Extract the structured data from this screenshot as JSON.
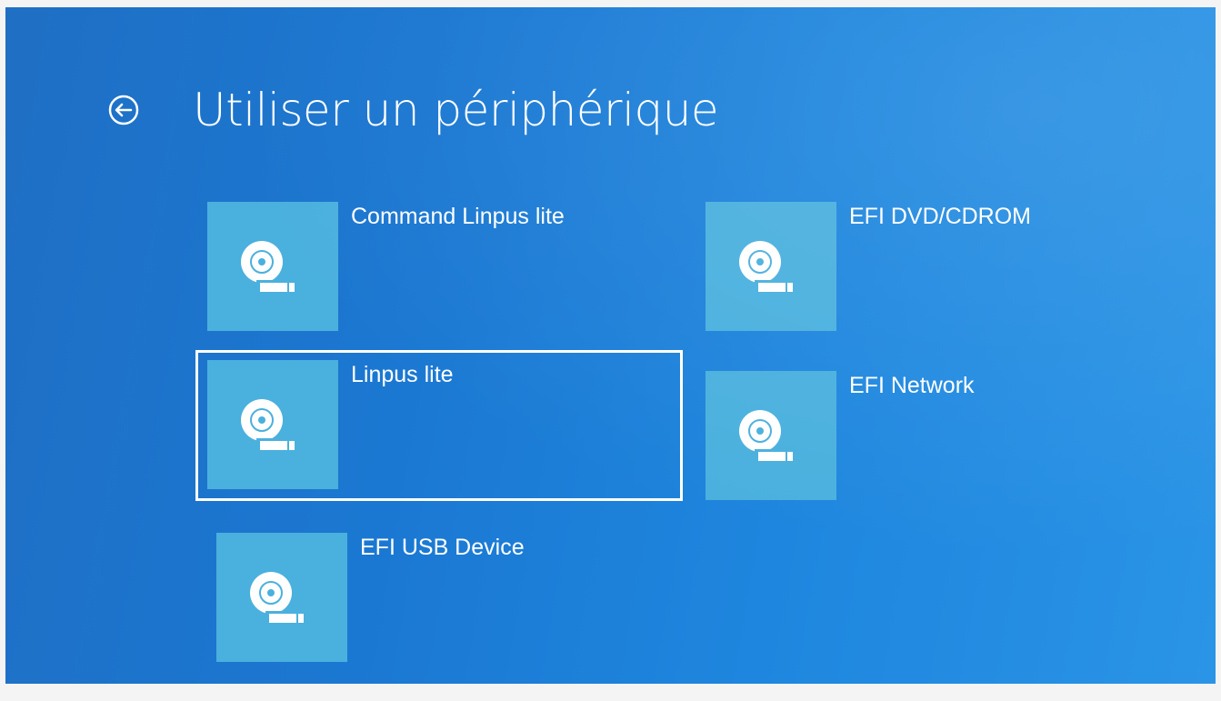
{
  "header": {
    "title": "Utiliser un périphérique",
    "back_icon": "back-arrow-circle-icon"
  },
  "devices": [
    {
      "label": "Command Linpus lite",
      "icon": "disc-drive-icon",
      "selected": false
    },
    {
      "label": "EFI DVD/CDROM",
      "icon": "disc-drive-icon",
      "selected": false
    },
    {
      "label": "Linpus lite",
      "icon": "disc-drive-icon",
      "selected": true
    },
    {
      "label": "EFI Network",
      "icon": "disc-drive-icon",
      "selected": false
    },
    {
      "label": "EFI USB Device",
      "icon": "disc-drive-icon",
      "selected": false
    }
  ],
  "colors": {
    "background": "#1b78d2",
    "tile": "#4ab0de",
    "text": "#ffffff"
  }
}
